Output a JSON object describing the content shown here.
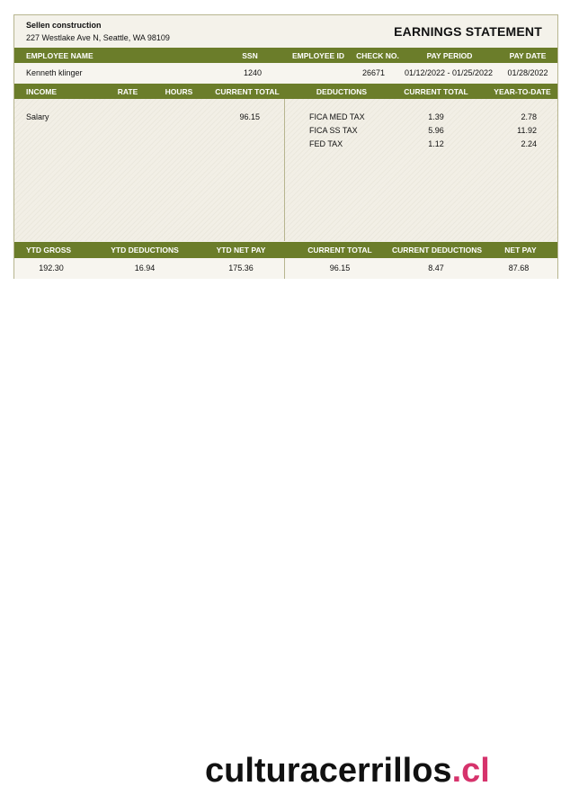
{
  "company": {
    "name": "Sellen construction",
    "address": "227 Westlake Ave N, Seattle, WA 98109"
  },
  "title": "EARNINGS STATEMENT",
  "employee_header": {
    "employee_name": "EMPLOYEE NAME",
    "ssn": "SSN",
    "employee_id": "EMPLOYEE ID",
    "check_no": "CHECK NO.",
    "pay_period": "PAY PERIOD",
    "pay_date": "PAY DATE"
  },
  "employee": {
    "name": "Kenneth klinger",
    "ssn": "1240",
    "employee_id": "",
    "check_no": "26671",
    "pay_period": "01/12/2022 - 01/25/2022",
    "pay_date": "01/28/2022"
  },
  "detail_header": {
    "income": "INCOME",
    "rate": "RATE",
    "hours": "HOURS",
    "current_total": "CURRENT TOTAL",
    "deductions": "DEDUCTIONS",
    "ded_current_total": "CURRENT TOTAL",
    "year_to_date": "YEAR-TO-DATE"
  },
  "income": [
    {
      "label": "Salary",
      "rate": "",
      "hours": "",
      "current_total": "96.15"
    }
  ],
  "deductions": [
    {
      "label": "FICA  MED TAX",
      "current_total": "1.39",
      "ytd": "2.78"
    },
    {
      "label": "FICA  SS TAX",
      "current_total": "5.96",
      "ytd": "11.92"
    },
    {
      "label": "FED TAX",
      "current_total": "1.12",
      "ytd": "2.24"
    }
  ],
  "summary_header": {
    "ytd_gross": "YTD GROSS",
    "ytd_deductions": "YTD DEDUCTIONS",
    "ytd_net_pay": "YTD NET PAY",
    "current_total": "CURRENT TOTAL",
    "current_deductions": "CURRENT DEDUCTIONS",
    "net_pay": "NET PAY"
  },
  "summary": {
    "ytd_gross": "192.30",
    "ytd_deductions": "16.94",
    "ytd_net_pay": "175.36",
    "current_total": "96.15",
    "current_deductions": "8.47",
    "net_pay": "87.68"
  },
  "watermark": {
    "main": "culturacerrillos",
    "tld": ".cl"
  },
  "colors": {
    "header_bar": "#6b7d2a",
    "watermark_tld": "#d6336c"
  }
}
